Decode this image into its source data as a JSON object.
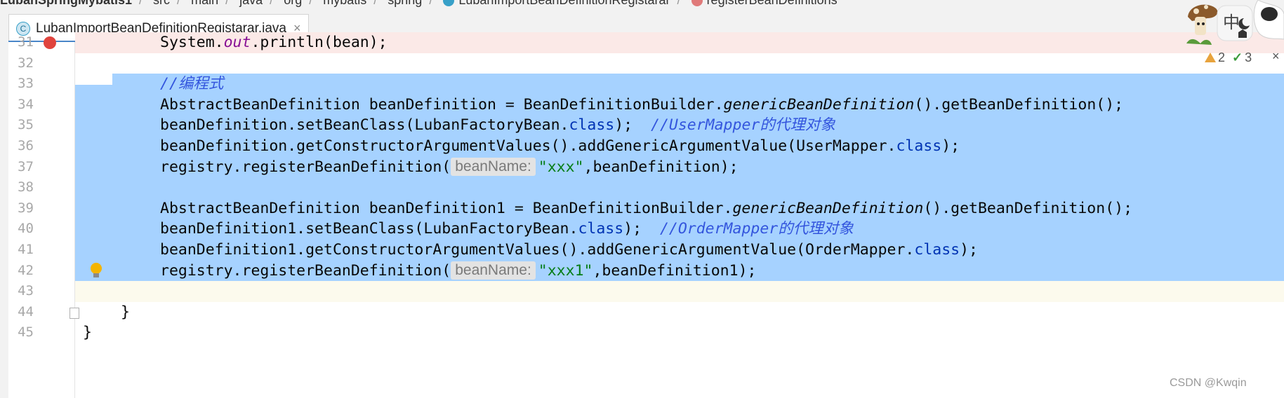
{
  "breadcrumb": {
    "items": [
      "LubanSpringMybatis1",
      "src",
      "main",
      "java",
      "org",
      "mybatis",
      "spring",
      "LubanImportBeanDefinitionRegistarar",
      "registerBeanDefinitions"
    ]
  },
  "tab": {
    "title": "LubanImportBeanDefinitionRegistarar.java",
    "class_icon": "C",
    "close": "×"
  },
  "inspections": {
    "warnings": "2",
    "weak_warnings": "3"
  },
  "mascot": {
    "text": "中"
  },
  "watermark": "CSDN @Kwqin",
  "lines": [
    {
      "num": "31",
      "tokens": [
        [
          "plain",
          "System."
        ],
        [
          "field",
          "out"
        ],
        [
          "plain",
          ".println(bean);"
        ]
      ]
    },
    {
      "num": "32",
      "tokens": []
    },
    {
      "num": "33",
      "tokens": [
        [
          "cm",
          "//编程式"
        ]
      ]
    },
    {
      "num": "34",
      "tokens": [
        [
          "plain",
          "AbstractBeanDefinition beanDefinition = BeanDefinitionBuilder."
        ],
        [
          "it",
          "genericBeanDefinition"
        ],
        [
          "plain",
          "().getBeanDefinition();"
        ]
      ]
    },
    {
      "num": "35",
      "tokens": [
        [
          "plain",
          "beanDefinition.setBeanClass(LubanFactoryBean."
        ],
        [
          "kw",
          "class"
        ],
        [
          "plain",
          ");  "
        ],
        [
          "cm",
          "//UserMapper的代理对象"
        ]
      ]
    },
    {
      "num": "36",
      "tokens": [
        [
          "plain",
          "beanDefinition.getConstructorArgumentValues().addGenericArgumentValue(UserMapper."
        ],
        [
          "kw",
          "class"
        ],
        [
          "plain",
          ");"
        ]
      ]
    },
    {
      "num": "37",
      "tokens": [
        [
          "plain",
          "registry.registerBeanDefinition("
        ],
        [
          "hint",
          "beanName:"
        ],
        [
          "str",
          "\"xxx\""
        ],
        [
          "plain",
          ",beanDefinition);"
        ]
      ]
    },
    {
      "num": "38",
      "tokens": []
    },
    {
      "num": "39",
      "tokens": [
        [
          "plain",
          "AbstractBeanDefinition beanDefinition1 = BeanDefinitionBuilder."
        ],
        [
          "it",
          "genericBeanDefinition"
        ],
        [
          "plain",
          "().getBeanDefinition();"
        ]
      ]
    },
    {
      "num": "40",
      "tokens": [
        [
          "plain",
          "beanDefinition1.setBeanClass(LubanFactoryBean."
        ],
        [
          "kw",
          "class"
        ],
        [
          "plain",
          ");  "
        ],
        [
          "cm",
          "//OrderMapper的代理对象"
        ]
      ]
    },
    {
      "num": "41",
      "tokens": [
        [
          "plain",
          "beanDefinition1.getConstructorArgumentValues().addGenericArgumentValue(OrderMapper."
        ],
        [
          "kw",
          "class"
        ],
        [
          "plain",
          ");"
        ]
      ]
    },
    {
      "num": "42",
      "tokens": [
        [
          "plain",
          "registry.registerBeanDefinition("
        ],
        [
          "hint",
          "beanName:"
        ],
        [
          "str",
          "\"xxx1\""
        ],
        [
          "plain",
          ",beanDefinition1);"
        ]
      ]
    },
    {
      "num": "43",
      "tokens": []
    },
    {
      "num": "44",
      "tokens": [
        [
          "plain",
          "}"
        ]
      ]
    },
    {
      "num": "45",
      "tokens": [
        [
          "plain",
          "}"
        ]
      ]
    }
  ]
}
